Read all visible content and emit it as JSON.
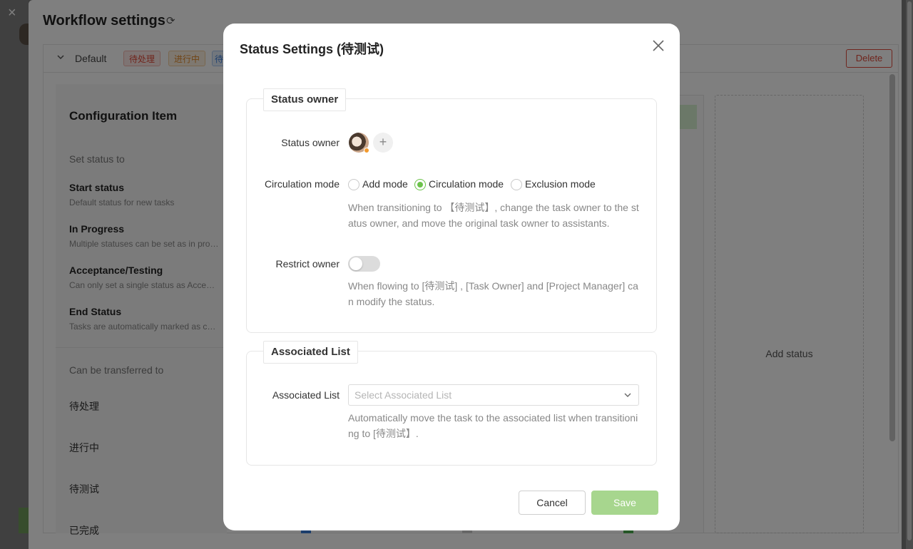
{
  "background": {
    "close_icon": "×",
    "title": "Workflow settings",
    "refresh_icon": "⟳",
    "tab_default": "Default",
    "tags": [
      "待处理",
      "进行中",
      "待"
    ],
    "delete_label": "Delete",
    "config_title": "Configuration Item",
    "set_status_to": "Set status to",
    "items": [
      {
        "title": "Start status",
        "desc": "Default status for new tasks"
      },
      {
        "title": "In Progress",
        "desc": "Multiple statuses can be set as in progress"
      },
      {
        "title": "Acceptance/Testing",
        "desc": "Can only set a single status as Acceptance/Testing"
      },
      {
        "title": "End Status",
        "desc": "Tasks are automatically marked as completed"
      }
    ],
    "can_be_transferred_to": "Can be transferred to",
    "states": [
      "待处理",
      "进行中",
      "待测试",
      "已完成"
    ],
    "add_status": "Add status"
  },
  "modal": {
    "title": "Status Settings (待测试)",
    "section_owner_legend": "Status owner",
    "status_owner_label": "Status owner",
    "add_owner_icon": "+",
    "circulation_mode_label": "Circulation mode",
    "modes": [
      {
        "label": "Add mode",
        "checked": false
      },
      {
        "label": "Circulation mode",
        "checked": true
      },
      {
        "label": "Exclusion mode",
        "checked": false
      }
    ],
    "circulation_help": "When transitioning to 【待测试】, change the task owner to the status owner, and move the original task owner to assistants.",
    "restrict_owner_label": "Restrict owner",
    "restrict_owner_enabled": false,
    "restrict_help": "When flowing to [待测试] , [Task Owner] and [Project Manager] can modify the status.",
    "section_list_legend": "Associated List",
    "associated_list_label": "Associated List",
    "associated_list_placeholder": "Select Associated List",
    "associated_help": "Automatically move the task to the associated list when transitioning to [待测试】.",
    "cancel_label": "Cancel",
    "save_label": "Save",
    "accent_color": "#6cc24a"
  }
}
